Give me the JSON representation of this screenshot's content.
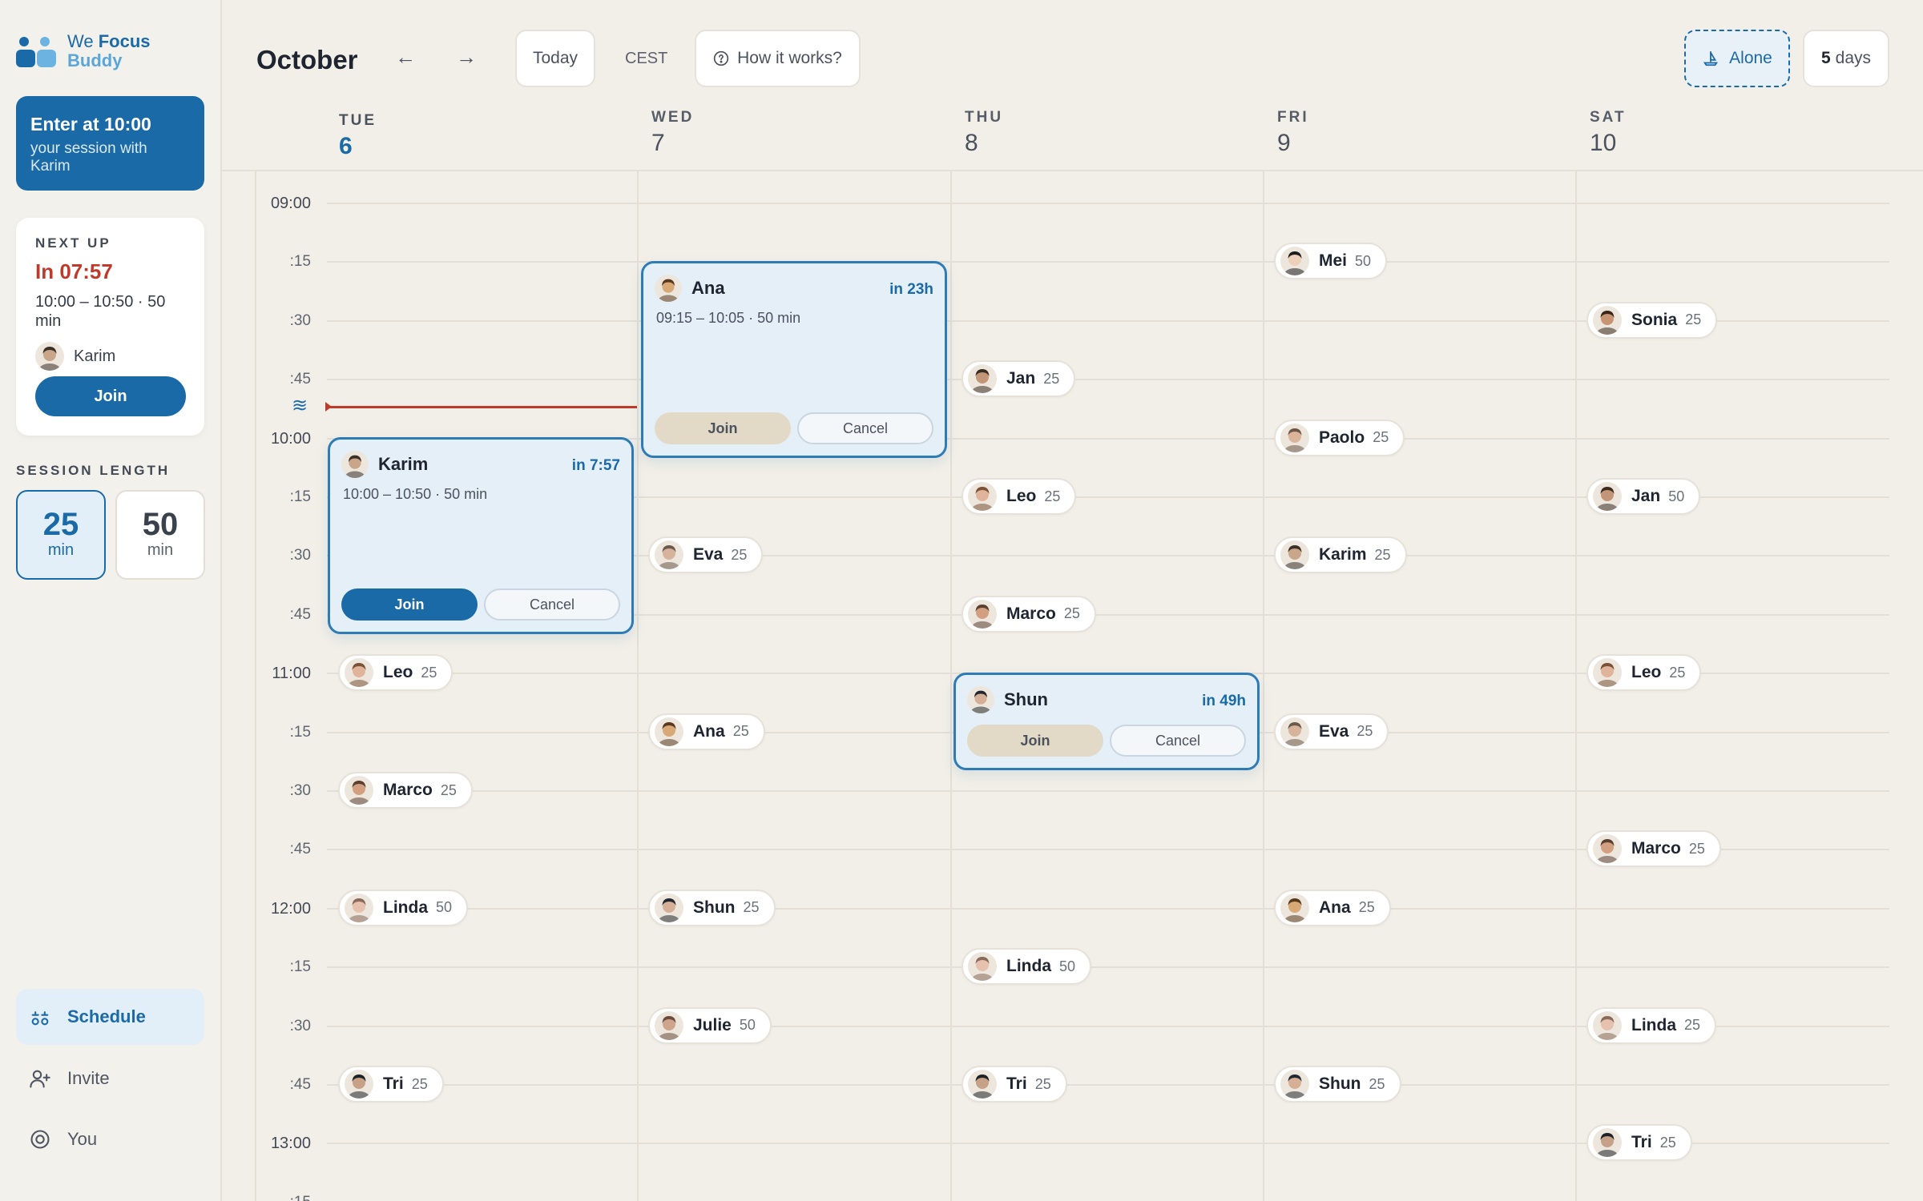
{
  "app": {
    "logo_line1_a": "We",
    "logo_line1_b": "Focus",
    "logo_line2": "Buddy"
  },
  "enter_card": {
    "title": "Enter at 10:00",
    "subtitle": "your session with Karim"
  },
  "next_up": {
    "label": "NEXT UP",
    "countdown": "In 07:57",
    "time": "10:00 – 10:50 · 50 min",
    "partner": "Karim",
    "join_label": "Join"
  },
  "session_length": {
    "label": "SESSION LENGTH",
    "options": [
      {
        "value": "25",
        "unit": "min",
        "selected": true
      },
      {
        "value": "50",
        "unit": "min",
        "selected": false
      }
    ]
  },
  "nav": {
    "schedule": "Schedule",
    "invite": "Invite",
    "you": "You"
  },
  "header": {
    "month": "October",
    "prev": "←",
    "next": "→",
    "today": "Today",
    "timezone": "CEST",
    "how": "How it works?",
    "mode": "Alone",
    "days_num": "5",
    "days_label": "days"
  },
  "days": [
    {
      "name": "TUE",
      "date": "6",
      "today": true
    },
    {
      "name": "WED",
      "date": "7"
    },
    {
      "name": "THU",
      "date": "8"
    },
    {
      "name": "FRI",
      "date": "9"
    },
    {
      "name": "SAT",
      "date": "10"
    }
  ],
  "time_labels": [
    "09:00",
    ":15",
    ":30",
    ":45",
    "10:00",
    ":15",
    ":30",
    ":45",
    "11:00",
    ":15",
    ":30",
    ":45",
    "12:00",
    ":15",
    ":30",
    ":45",
    "13:00",
    ":15"
  ],
  "now_marker": "≋",
  "sessions": {
    "karim": {
      "name": "Karim",
      "in": "in 7:57",
      "meta": "10:00 – 10:50 · 50 min",
      "join": "Join",
      "cancel": "Cancel"
    },
    "ana": {
      "name": "Ana",
      "in": "in 23h",
      "meta": "09:15 – 10:05 · 50 min",
      "join": "Join",
      "cancel": "Cancel"
    },
    "shun": {
      "name": "Shun",
      "in": "in 49h",
      "join": "Join",
      "cancel": "Cancel"
    }
  },
  "chips": [
    {
      "day": 0,
      "slot": 8,
      "name": "Leo",
      "len": "25"
    },
    {
      "day": 0,
      "slot": 10,
      "name": "Marco",
      "len": "25"
    },
    {
      "day": 0,
      "slot": 12,
      "name": "Linda",
      "len": "50"
    },
    {
      "day": 0,
      "slot": 15,
      "name": "Tri",
      "len": "25"
    },
    {
      "day": 1,
      "slot": 6,
      "name": "Eva",
      "len": "25"
    },
    {
      "day": 1,
      "slot": 9,
      "name": "Ana",
      "len": "25"
    },
    {
      "day": 1,
      "slot": 12,
      "name": "Shun",
      "len": "25"
    },
    {
      "day": 1,
      "slot": 14,
      "name": "Julie",
      "len": "50"
    },
    {
      "day": 2,
      "slot": 3,
      "name": "Jan",
      "len": "25"
    },
    {
      "day": 2,
      "slot": 5,
      "name": "Leo",
      "len": "25"
    },
    {
      "day": 2,
      "slot": 7,
      "name": "Marco",
      "len": "25"
    },
    {
      "day": 2,
      "slot": 13,
      "name": "Linda",
      "len": "50"
    },
    {
      "day": 2,
      "slot": 15,
      "name": "Tri",
      "len": "25"
    },
    {
      "day": 3,
      "slot": 1,
      "name": "Mei",
      "len": "50"
    },
    {
      "day": 3,
      "slot": 4,
      "name": "Paolo",
      "len": "25"
    },
    {
      "day": 3,
      "slot": 6,
      "name": "Karim",
      "len": "25"
    },
    {
      "day": 3,
      "slot": 9,
      "name": "Eva",
      "len": "25"
    },
    {
      "day": 3,
      "slot": 12,
      "name": "Ana",
      "len": "25"
    },
    {
      "day": 3,
      "slot": 15,
      "name": "Shun",
      "len": "25"
    },
    {
      "day": 4,
      "slot": 2,
      "name": "Sonia",
      "len": "25"
    },
    {
      "day": 4,
      "slot": 5,
      "name": "Jan",
      "len": "50"
    },
    {
      "day": 4,
      "slot": 8,
      "name": "Leo",
      "len": "25"
    },
    {
      "day": 4,
      "slot": 11,
      "name": "Marco",
      "len": "25"
    },
    {
      "day": 4,
      "slot": 14,
      "name": "Linda",
      "len": "25"
    },
    {
      "day": 4,
      "slot": 16,
      "name": "Tri",
      "len": "25"
    }
  ],
  "colors": {
    "accent": "#1a6aa8",
    "alert": "#c0392b",
    "background": "#f2efe8"
  }
}
